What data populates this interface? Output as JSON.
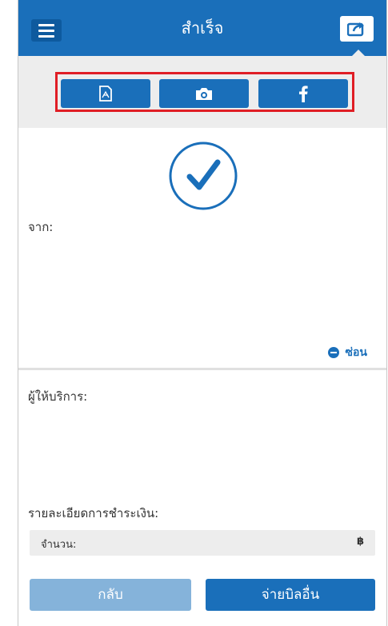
{
  "header": {
    "title": "สำเร็จ",
    "menu_icon": "hamburger-menu-icon",
    "share_icon": "share-icon"
  },
  "share_options": [
    {
      "icon": "pdf-icon"
    },
    {
      "icon": "camera-icon"
    },
    {
      "icon": "facebook-icon"
    }
  ],
  "status": {
    "icon": "check-circle-icon"
  },
  "from": {
    "label": "จาก:"
  },
  "hide_link": {
    "label": "ซ่อน"
  },
  "provider": {
    "label": "ผู้ให้บริการ:"
  },
  "payment": {
    "label": "รายละเอียดการชำระเงิน:",
    "amount_label": "จำนวน:",
    "amount_value": "฿"
  },
  "buttons": {
    "back_label": "กลับ",
    "pay_other_label": "จ่ายบิลอื่น"
  },
  "colors": {
    "primary": "#1a6fba",
    "highlight_border": "#e01e25",
    "disabled_button": "#85b3da"
  }
}
